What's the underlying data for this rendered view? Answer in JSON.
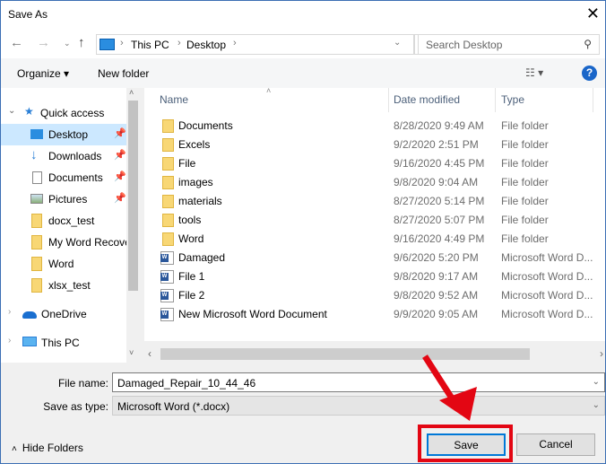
{
  "window": {
    "title": "Save As",
    "close_icon": "close-icon"
  },
  "nav": {
    "crumbs": [
      "This PC",
      "Desktop"
    ],
    "search_placeholder": "Search Desktop"
  },
  "toolbar": {
    "organize": "Organize ▾",
    "new_folder": "New folder",
    "help": "?"
  },
  "sidebar": {
    "items": [
      {
        "label": "Quick access",
        "pinned": false
      },
      {
        "label": "Desktop",
        "pinned": true,
        "selected": true
      },
      {
        "label": "Downloads",
        "pinned": true
      },
      {
        "label": "Documents",
        "pinned": true
      },
      {
        "label": "Pictures",
        "pinned": true
      },
      {
        "label": "docx_test"
      },
      {
        "label": "My Word Recove"
      },
      {
        "label": "Word"
      },
      {
        "label": "xlsx_test"
      },
      {
        "label": "OneDrive"
      },
      {
        "label": "This PC"
      }
    ]
  },
  "columns": {
    "name": "Name",
    "date": "Date modified",
    "type": "Type"
  },
  "files": [
    {
      "name": "Documents",
      "date": "8/28/2020 9:49 AM",
      "type": "File folder",
      "kind": "folder"
    },
    {
      "name": "Excels",
      "date": "9/2/2020 2:51 PM",
      "type": "File folder",
      "kind": "folder"
    },
    {
      "name": "File",
      "date": "9/16/2020 4:45 PM",
      "type": "File folder",
      "kind": "folder"
    },
    {
      "name": "images",
      "date": "9/8/2020 9:04 AM",
      "type": "File folder",
      "kind": "folder"
    },
    {
      "name": "materials",
      "date": "8/27/2020 5:14 PM",
      "type": "File folder",
      "kind": "folder"
    },
    {
      "name": "tools",
      "date": "8/27/2020 5:07 PM",
      "type": "File folder",
      "kind": "folder"
    },
    {
      "name": "Word",
      "date": "9/16/2020 4:49 PM",
      "type": "File folder",
      "kind": "folder"
    },
    {
      "name": "Damaged",
      "date": "9/6/2020 5:20 PM",
      "type": "Microsoft Word D...",
      "kind": "word"
    },
    {
      "name": "File 1",
      "date": "9/8/2020 9:17 AM",
      "type": "Microsoft Word D...",
      "kind": "word"
    },
    {
      "name": "File 2",
      "date": "9/8/2020 9:52 AM",
      "type": "Microsoft Word D...",
      "kind": "word"
    },
    {
      "name": "New Microsoft Word Document",
      "date": "9/9/2020 9:05 AM",
      "type": "Microsoft Word D...",
      "kind": "word"
    }
  ],
  "form": {
    "filename_label": "File name:",
    "filename": "Damaged_Repair_10_44_46",
    "type_label": "Save as type:",
    "type": "Microsoft Word (*.docx)"
  },
  "buttons": {
    "save": "Save",
    "cancel": "Cancel",
    "hide_folders": "Hide Folders"
  },
  "annotation": {
    "color": "#e30613"
  }
}
